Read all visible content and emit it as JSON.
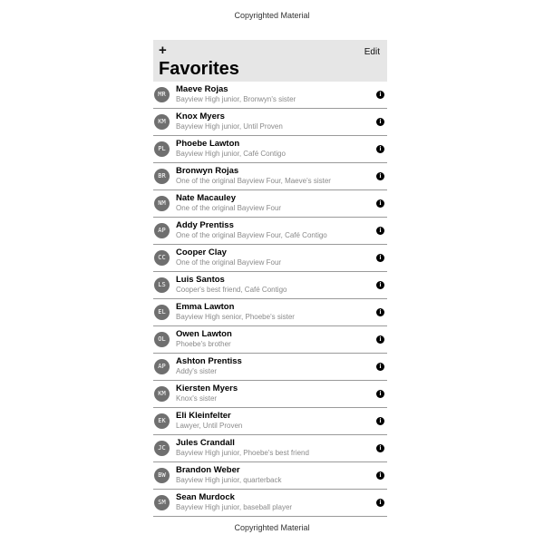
{
  "watermark": {
    "top": "Copyrighted Material",
    "bottom": "Copyrighted Material"
  },
  "header": {
    "add_label": "+",
    "edit_label": "Edit",
    "title": "Favorites"
  },
  "info_glyph": "i",
  "contacts": [
    {
      "initials": "MR",
      "name": "Maeve Rojas",
      "subtitle": "Bayview High junior, Bronwyn's sister"
    },
    {
      "initials": "KM",
      "name": "Knox Myers",
      "subtitle": "Bayview High junior, Until Proven"
    },
    {
      "initials": "PL",
      "name": "Phoebe Lawton",
      "subtitle": "Bayview High junior, Café Contigo"
    },
    {
      "initials": "BR",
      "name": "Bronwyn Rojas",
      "subtitle": "One of the original Bayview Four, Maeve's sister"
    },
    {
      "initials": "NM",
      "name": "Nate Macauley",
      "subtitle": "One of the original Bayview Four"
    },
    {
      "initials": "AP",
      "name": "Addy Prentiss",
      "subtitle": "One of the original Bayview Four, Café Contigo"
    },
    {
      "initials": "CC",
      "name": "Cooper Clay",
      "subtitle": "One of the original Bayview Four"
    },
    {
      "initials": "LS",
      "name": "Luis Santos",
      "subtitle": "Cooper's best friend, Café Contigo"
    },
    {
      "initials": "EL",
      "name": "Emma Lawton",
      "subtitle": "Bayview High senior, Phoebe's sister"
    },
    {
      "initials": "OL",
      "name": "Owen Lawton",
      "subtitle": "Phoebe's brother"
    },
    {
      "initials": "AP",
      "name": "Ashton Prentiss",
      "subtitle": "Addy's sister"
    },
    {
      "initials": "KM",
      "name": "Kiersten Myers",
      "subtitle": "Knox's sister"
    },
    {
      "initials": "EK",
      "name": "Eli Kleinfelter",
      "subtitle": "Lawyer, Until Proven"
    },
    {
      "initials": "JC",
      "name": "Jules Crandall",
      "subtitle": "Bayview High junior, Phoebe's best friend"
    },
    {
      "initials": "BW",
      "name": "Brandon Weber",
      "subtitle": "Bayview High junior, quarterback"
    },
    {
      "initials": "SM",
      "name": "Sean Murdock",
      "subtitle": "Bayview High junior, baseball player"
    }
  ]
}
